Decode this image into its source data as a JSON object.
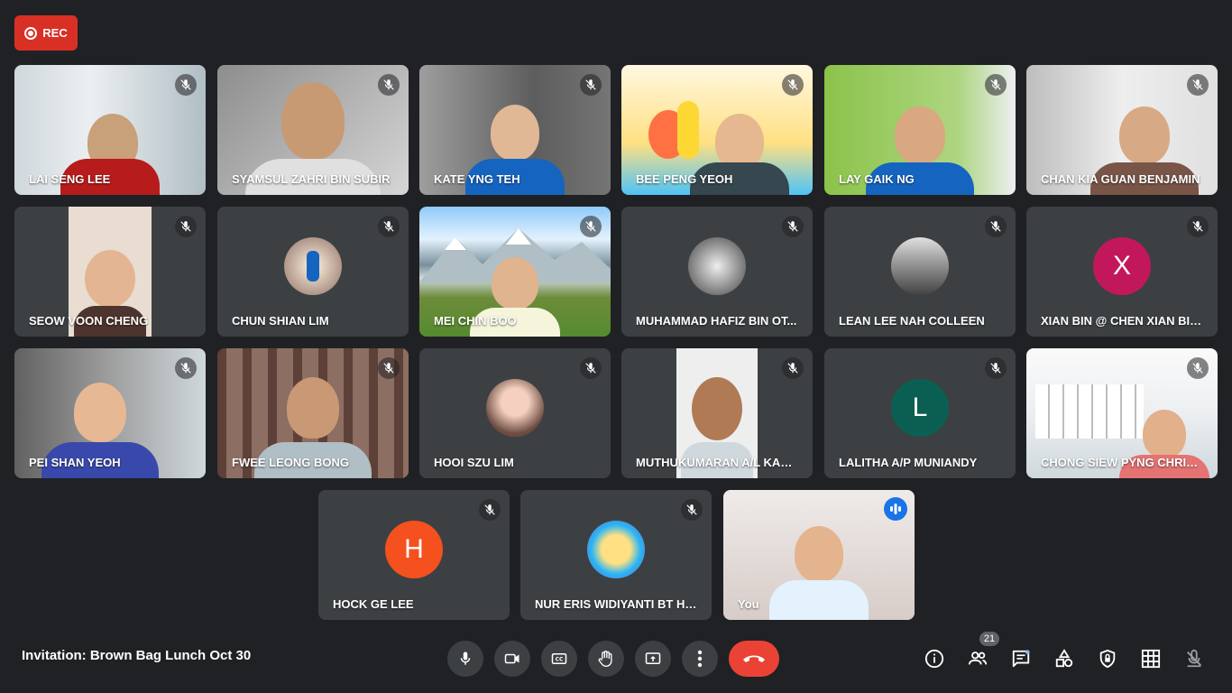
{
  "recording": {
    "label": "REC"
  },
  "participants": [
    {
      "name": "LAI SENG LEE"
    },
    {
      "name": "SYAMSUL ZAHRI BIN SUBIR"
    },
    {
      "name": "KATE YNG TEH"
    },
    {
      "name": "BEE PENG YEOH"
    },
    {
      "name": "LAY GAIK NG"
    },
    {
      "name": "CHAN KIA GUAN BENJAMIN"
    },
    {
      "name": "SEOW VOON CHENG"
    },
    {
      "name": "CHUN SHIAN LIM"
    },
    {
      "name": "MEI CHIN BOO"
    },
    {
      "name": "MUHAMMAD HAFIZ BIN OT..."
    },
    {
      "name": "LEAN LEE NAH COLLEEN"
    },
    {
      "name": "XIAN BIN @ CHEN XIAN BIN ...",
      "initial": "X",
      "color": "#c2185b"
    },
    {
      "name": "PEI SHAN YEOH"
    },
    {
      "name": "FWEE LEONG BONG"
    },
    {
      "name": "HOOI SZU LIM"
    },
    {
      "name": "MUTHUKUMARAN A/L KAN..."
    },
    {
      "name": "LALITHA A/P MUNIANDY",
      "initial": "L",
      "color": "#0b5f52"
    },
    {
      "name": "CHONG SIEW PYNG CHRIS..."
    },
    {
      "name": "HOCK GE LEE",
      "initial": "H",
      "color": "#f4511e"
    },
    {
      "name": "NUR ERIS WIDIYANTI BT HUS..."
    },
    {
      "name": "You"
    }
  ],
  "meeting": {
    "title": "Invitation: Brown Bag Lunch Oct 30"
  },
  "people_count": "21",
  "colors": {
    "background": "#202124",
    "tile": "#3c4043",
    "end_call": "#ea4335",
    "rec": "#d93025",
    "self_outline": "#8ab4f8"
  },
  "icons": [
    "mic-icon",
    "camera-icon",
    "captions-icon",
    "raise-hand-icon",
    "present-icon",
    "more-icon",
    "end-call-icon",
    "info-icon",
    "people-icon",
    "chat-icon",
    "activities-icon",
    "host-controls-icon",
    "layout-icon",
    "mic-off-icon"
  ]
}
